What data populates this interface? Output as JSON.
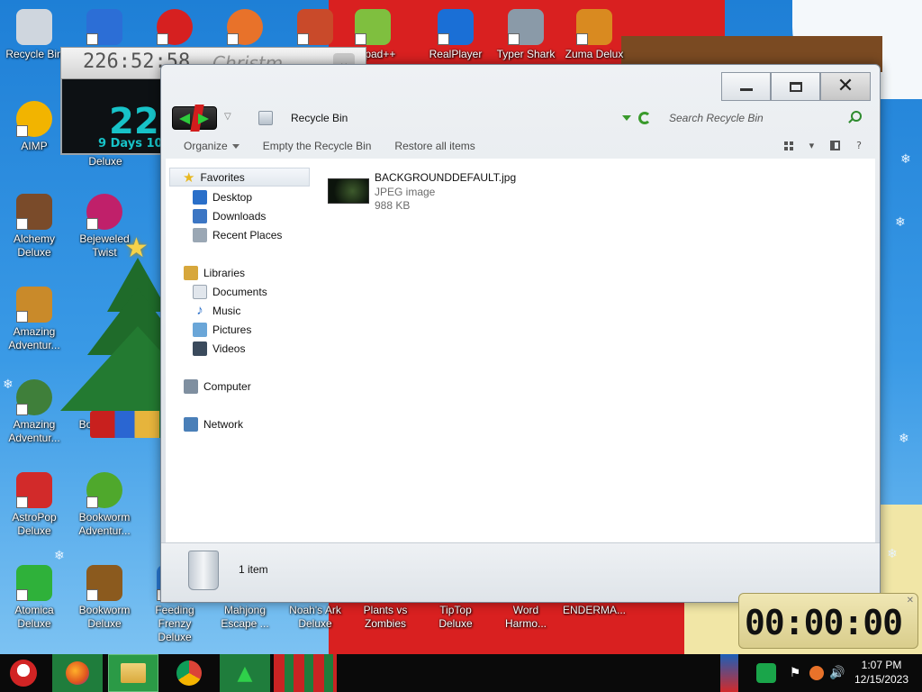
{
  "desktop": {
    "icons": [
      {
        "label": "Recycle Bin",
        "color": "#cfd6de"
      },
      {
        "label": "AIMP",
        "color": "#f2b400"
      },
      {
        "label": "Alchemy Deluxe",
        "color": "#7a4b2a"
      },
      {
        "label": "Amazing Adventur...",
        "color": "#c98a2a"
      },
      {
        "label": "Amazing Adventur...",
        "color": "#3f7f3a"
      },
      {
        "label": "AstroPop Deluxe",
        "color": "#d22a2a"
      },
      {
        "label": "Atomica Deluxe",
        "color": "#2fb13a"
      },
      {
        "label": "Deluxe",
        "color": "#2c6ed6"
      },
      {
        "label": "Bejeweled Twist",
        "color": "#c0206a"
      },
      {
        "label": "Bookstor...",
        "color": "#7b4a1e"
      },
      {
        "label": "Bookworm Adventur...",
        "color": "#4fa82c"
      },
      {
        "label": "Bookworm Deluxe",
        "color": "#8b5a1e"
      },
      {
        "label": "Feeding Frenzy Deluxe",
        "color": "#2a7ad6"
      },
      {
        "label": "Mahjong Escape ...",
        "color": "#b03030"
      },
      {
        "label": "Noah's Ark Deluxe",
        "color": "#2a7f3a"
      },
      {
        "label": "Plants vs Zombies",
        "color": "#4fb72c"
      },
      {
        "label": "TipTop Deluxe",
        "color": "#e07a20"
      },
      {
        "label": "Word Harmo...",
        "color": "#c06a2a"
      },
      {
        "label": "ENDERMA...",
        "color": "#444444"
      },
      {
        "label": "etepad++",
        "color": "#7fbf3f"
      },
      {
        "label": "RealPlayer",
        "color": "#1a6fd6"
      },
      {
        "label": "Typer Shark",
        "color": "#8a9aa8"
      },
      {
        "label": "Zuma Delux",
        "color": "#d98a20"
      }
    ]
  },
  "gadget": {
    "clock": "226:52:58",
    "title": "Christm",
    "big_number": "22",
    "days_text": "9 Days 10"
  },
  "window": {
    "title": "Recycle Bin",
    "search_placeholder": "Search Recycle Bin",
    "commands": [
      "Organize",
      "Empty the Recycle Bin",
      "Restore all items"
    ],
    "nav": {
      "favorites_label": "Favorites",
      "favorites": [
        "Desktop",
        "Downloads",
        "Recent Places"
      ],
      "libraries_label": "Libraries",
      "libraries": [
        "Documents",
        "Music",
        "Pictures",
        "Videos"
      ],
      "computer_label": "Computer",
      "network_label": "Network"
    },
    "file": {
      "name": "BACKGROUNDDEFAULT.jpg",
      "type": "JPEG image",
      "size": "988 KB"
    },
    "status": {
      "count": "1 item"
    }
  },
  "timer": {
    "digits": "00:00:00"
  },
  "taskbar": {
    "time": "1:07 PM",
    "date": "12/15/2023"
  },
  "colors": {
    "accent_green": "#2dcc3c",
    "accent_red": "#d21d1d"
  }
}
